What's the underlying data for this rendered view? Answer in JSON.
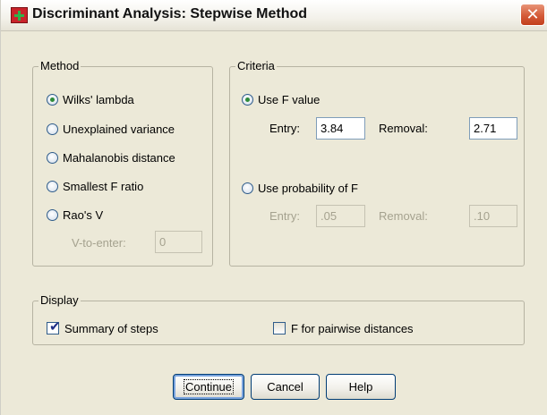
{
  "window": {
    "title": "Discriminant Analysis: Stepwise Method",
    "close_glyph": "✕"
  },
  "method": {
    "legend": "Method",
    "options": [
      {
        "label": "Wilks' lambda",
        "selected": true
      },
      {
        "label": "Unexplained variance",
        "selected": false
      },
      {
        "label": "Mahalanobis distance",
        "selected": false
      },
      {
        "label": "Smallest F ratio",
        "selected": false
      },
      {
        "label": "Rao's V",
        "selected": false
      }
    ],
    "v_to_enter_label": "V-to-enter:",
    "v_to_enter_value": "0"
  },
  "criteria": {
    "legend": "Criteria",
    "use_f_value": {
      "label": "Use F value",
      "selected": true
    },
    "f_entry_label": "Entry:",
    "f_entry_value": "3.84",
    "f_removal_label": "Removal:",
    "f_removal_value": "2.71",
    "use_probability": {
      "label": "Use probability of F",
      "selected": false
    },
    "p_entry_label": "Entry:",
    "p_entry_value": ".05",
    "p_removal_label": "Removal:",
    "p_removal_value": ".10"
  },
  "display": {
    "legend": "Display",
    "summary_of_steps": {
      "label": "Summary of steps",
      "checked": true
    },
    "f_pairwise": {
      "label": "F for pairwise distances",
      "checked": false
    }
  },
  "buttons": {
    "continue": "Continue",
    "cancel": "Cancel",
    "help": "Help"
  },
  "colors": {
    "dialog_bg": "#ece9d8",
    "close_button": "#d45a38",
    "radio_selected": "#2e8b3a",
    "checkmark": "#1f2f86"
  }
}
